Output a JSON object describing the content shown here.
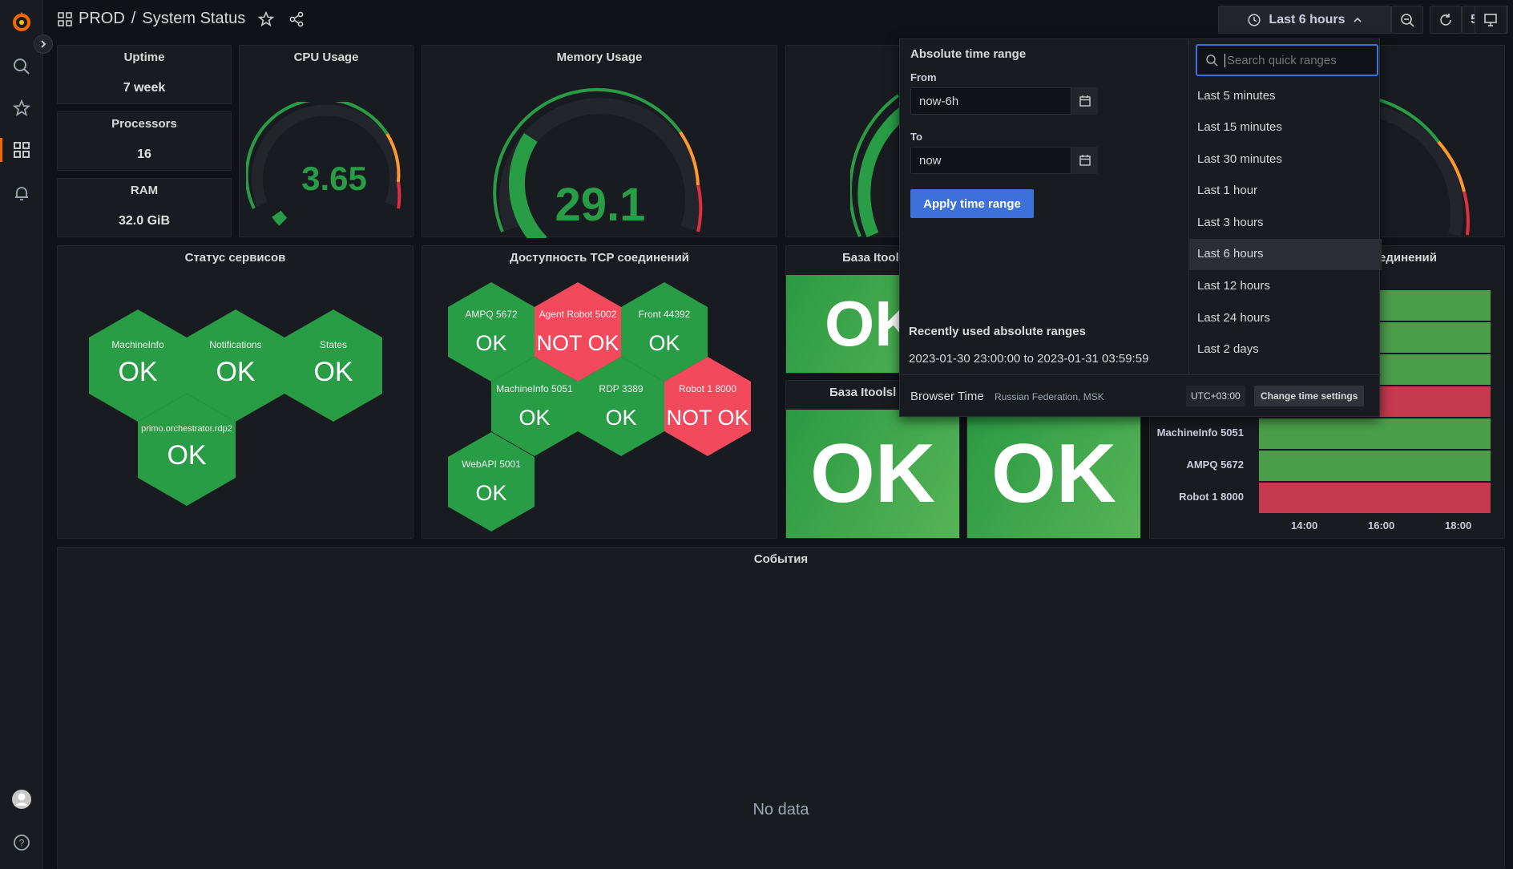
{
  "topbar": {
    "folder": "PROD",
    "separator": "/",
    "title": "System Status",
    "time_range_label": "Last 6 hours",
    "refresh_interval": "5s"
  },
  "stats": {
    "uptime": {
      "title": "Uptime",
      "value": "7 week"
    },
    "processors": {
      "title": "Processors",
      "value": "16"
    },
    "ram": {
      "title": "RAM",
      "value": "32.0 GiB"
    }
  },
  "gauges": {
    "cpu": {
      "title": "CPU Usage",
      "value": "3.65",
      "percent": 3.65
    },
    "memory": {
      "title": "Memory Usage",
      "value": "29.1",
      "percent": 29.1
    }
  },
  "services": {
    "title": "Статус сервисов",
    "items": [
      {
        "label": "MachineInfo",
        "status": "OK"
      },
      {
        "label": "Notifications",
        "status": "OK"
      },
      {
        "label": "States",
        "status": "OK"
      },
      {
        "label": "primo.orchestrator.rdp2",
        "status": "OK"
      }
    ]
  },
  "tcp": {
    "title": "Доступность TCP соединений",
    "items": [
      {
        "label": "AMPQ 5672",
        "status": "OK"
      },
      {
        "label": "Agent Robot 5002",
        "status": "NOT OK"
      },
      {
        "label": "Front 44392",
        "status": "OK"
      },
      {
        "label": "MachineInfo 5051",
        "status": "OK"
      },
      {
        "label": "RDP 3389",
        "status": "OK"
      },
      {
        "label": "Robot 1 8000",
        "status": "NOT OK"
      },
      {
        "label": "WebAPI 5001",
        "status": "OK"
      }
    ]
  },
  "db": {
    "title1": "База Itools",
    "value1": "OK",
    "title2": "База Itoolsl",
    "value2": "OK",
    "value3": "OK"
  },
  "heatmap": {
    "title_fragment": "единений",
    "rows": [
      "MachineInfo 5051",
      "AMPQ 5672",
      "Robot 1 8000"
    ],
    "x_ticks": [
      "14:00",
      "16:00",
      "18:00"
    ]
  },
  "events": {
    "title": "События",
    "empty": "No data"
  },
  "picker": {
    "absolute_title": "Absolute time range",
    "from_label": "From",
    "from_value": "now-6h",
    "to_label": "To",
    "to_value": "now",
    "apply_label": "Apply time range",
    "recent_title": "Recently used absolute ranges",
    "recent_range": "2023-01-30 23:00:00 to 2023-01-31 03:59:59",
    "search_placeholder": "Search quick ranges",
    "quick_ranges": [
      "Last 5 minutes",
      "Last 15 minutes",
      "Last 30 minutes",
      "Last 1 hour",
      "Last 3 hours",
      "Last 6 hours",
      "Last 12 hours",
      "Last 24 hours",
      "Last 2 days"
    ],
    "selected_index": 5,
    "browser_time_label": "Browser Time",
    "timezone_name": "Russian Federation, MSK",
    "utc_offset": "UTC+03:00",
    "change_settings_label": "Change time settings"
  },
  "colors": {
    "ok": "#299c46",
    "bad": "#f2495c",
    "accent": "#3d71d9",
    "brand": "#f46800"
  }
}
